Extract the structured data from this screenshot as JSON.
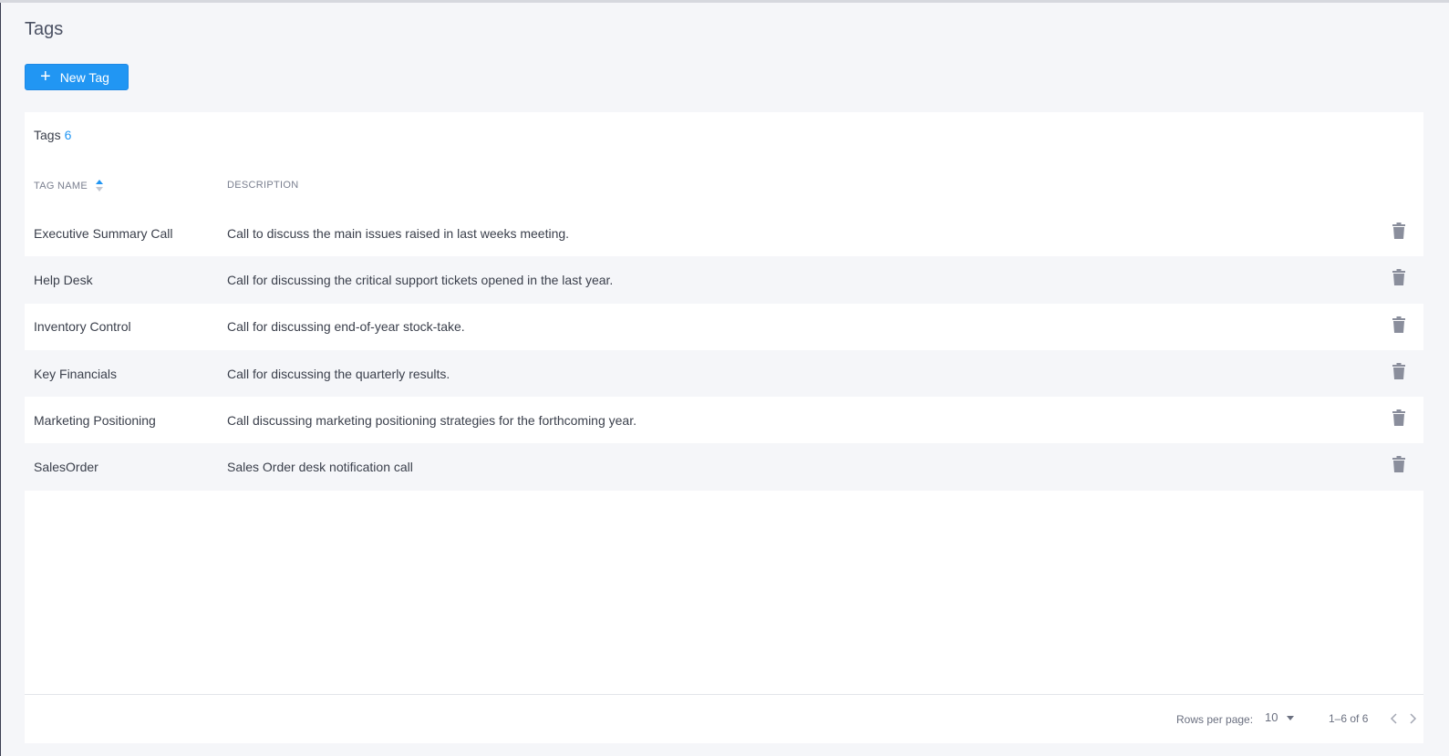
{
  "page": {
    "title": "Tags"
  },
  "toolbar": {
    "new_tag_label": "New Tag"
  },
  "table": {
    "header_title": "Tags",
    "count": "6",
    "columns": {
      "name": "Tag Name",
      "description": "Description"
    },
    "sort": {
      "column": "Tag Name",
      "direction": "ascending"
    },
    "rows": [
      {
        "name": "Executive Summary Call",
        "description": "Call to discuss the main issues raised in last weeks meeting."
      },
      {
        "name": "Help Desk",
        "description": "Call for discussing the critical support tickets opened in the last year."
      },
      {
        "name": "Inventory Control",
        "description": "Call for discussing end-of-year stock-take."
      },
      {
        "name": "Key Financials",
        "description": "Call for discussing the quarterly results."
      },
      {
        "name": "Marketing Positioning",
        "description": "Call discussing marketing positioning strategies for the forthcoming year."
      },
      {
        "name": "SalesOrder",
        "description": "Sales Order desk notification call"
      }
    ]
  },
  "pagination": {
    "rows_per_page_label": "Rows per page:",
    "rows_per_page_value": "10",
    "range_text": "1–6 of 6"
  },
  "icons": {
    "add": "plus-icon",
    "sort": "sort-ascending-icon",
    "delete": "trash-icon",
    "dropdown": "caret-down-icon",
    "prev": "chevron-left-icon",
    "next": "chevron-right-icon"
  },
  "colors": {
    "accent": "#2196f3",
    "background": "#f5f6f9",
    "card": "#ffffff",
    "icon": "#8a8e9c"
  }
}
